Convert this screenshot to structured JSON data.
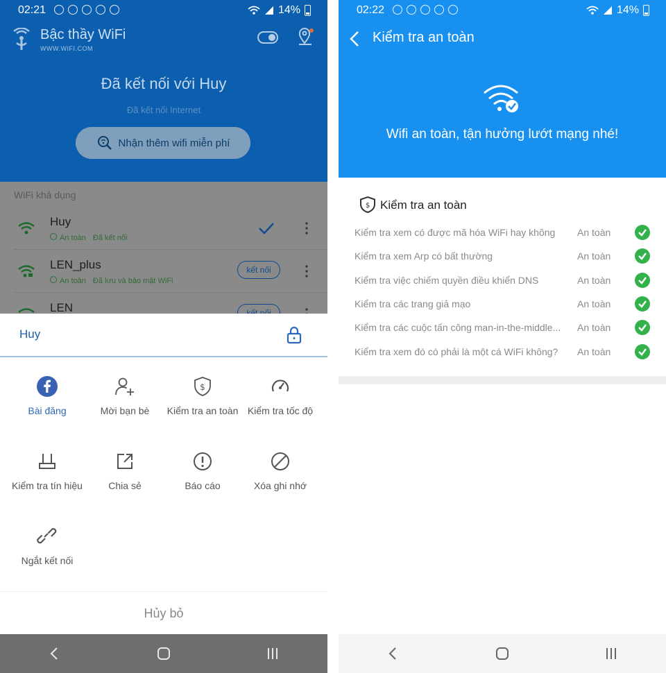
{
  "left": {
    "status": {
      "time": "02:21",
      "battery": "14%"
    },
    "header": {
      "app_name": "Bậc thầy WiFi",
      "app_url": "WWW.WIFI.COM",
      "connected_title": "Đã kết nối với Huy",
      "connected_sub": "Đã kết nối Internet",
      "free_wifi_button": "Nhận thêm wifi miễn phí"
    },
    "wifi_list": {
      "header": "WiFi khả dụng",
      "items": [
        {
          "name": "Huy",
          "status": "An toàn",
          "note": "Đã kết nối"
        },
        {
          "name": "LEN_plus",
          "status": "An toàn",
          "note": "Đã lưu và bảo mật WiFi",
          "action": "kết nối"
        },
        {
          "name": "LEN",
          "action": "kết nối"
        }
      ]
    },
    "sheet": {
      "title": "Huy",
      "actions": [
        {
          "label": "Bài đăng",
          "icon": "facebook-icon"
        },
        {
          "label": "Mời bạn bè",
          "icon": "add-user-icon"
        },
        {
          "label": "Kiểm tra an toàn",
          "icon": "shield-icon"
        },
        {
          "label": "Kiểm tra tốc độ",
          "icon": "speedometer-icon"
        },
        {
          "label": "Kiểm tra tín hiệu",
          "icon": "router-icon"
        },
        {
          "label": "Chia sẻ",
          "icon": "share-icon"
        },
        {
          "label": "Báo cáo",
          "icon": "alert-icon"
        },
        {
          "label": "Xóa ghi nhớ",
          "icon": "forbidden-icon"
        },
        {
          "label": "Ngắt kết nối",
          "icon": "broken-link-icon"
        }
      ],
      "cancel": "Hủy bỏ"
    }
  },
  "right": {
    "status": {
      "time": "02:22",
      "battery": "14%"
    },
    "header": {
      "title": "Kiểm tra an toàn",
      "hero_text": "Wifi an toàn, tận hưởng lướt mạng nhé!"
    },
    "section_title": "Kiểm tra an toàn",
    "checks": [
      {
        "label": "Kiểm tra xem có được mã hóa WiFi hay không",
        "status": "An toàn"
      },
      {
        "label": "Kiểm tra xem Arp có bất thường",
        "status": "An toàn"
      },
      {
        "label": "Kiểm tra việc chiếm quyền điều khiển DNS",
        "status": "An toàn"
      },
      {
        "label": "Kiểm tra các trang giả mạo",
        "status": "An toàn"
      },
      {
        "label": "Kiểm tra các cuộc tấn công man-in-the-middle...",
        "status": "An toàn"
      },
      {
        "label": "Kiểm tra xem đó có phải là một cá WiFi không?",
        "status": "An toàn"
      }
    ]
  },
  "colors": {
    "left_header": "#0b5fae",
    "right_header": "#1890f0",
    "safe_green": "#33b14a",
    "accent_blue": "#2e67b8"
  }
}
